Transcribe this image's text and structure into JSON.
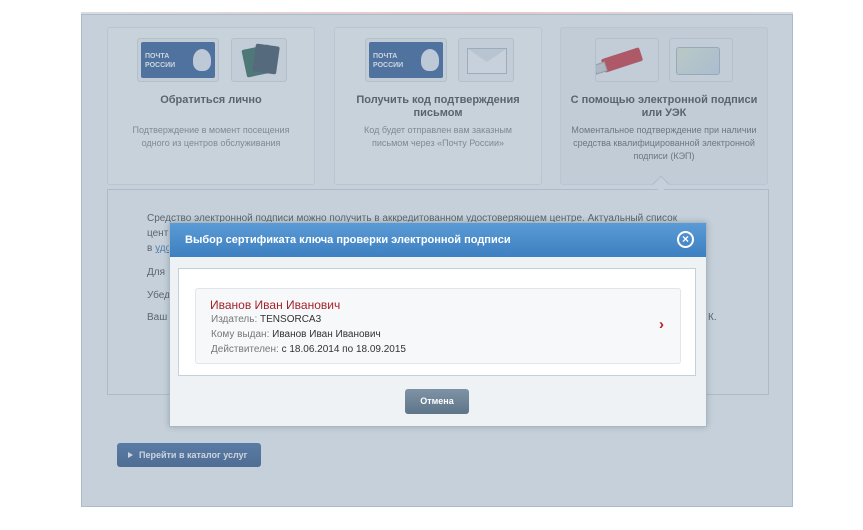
{
  "cards": [
    {
      "title": "Обратиться лично",
      "description": "Подтверждение в момент посещения одного из центров обслуживания"
    },
    {
      "title": "Получить код подтверждения письмом",
      "description": "Код будет отправлен вам заказным письмом через «Почту России»"
    },
    {
      "title": "С помощью электронной подписи или УЭК",
      "description": "Моментальное подтверждение при наличии средства квалифицированной электронной подписи (КЭП)"
    }
  ],
  "logo": {
    "line1": "ПОЧТА",
    "line2": "РОССИИ"
  },
  "info": {
    "line1": "Средство электронной подписи можно получить в аккредитованном удостоверяющем центре. Актуальный список",
    "line2": "цент",
    "line3_prefix": "в",
    "line3_link": "удо",
    "line4": "Для",
    "line5": "Убед",
    "line6": "Ваш",
    "line6_tail": "К."
  },
  "catalog_button": "Перейти в каталог услуг",
  "dialog": {
    "title": "Выбор сертификата ключа проверки электронной подписи",
    "close_symbol": "×",
    "cancel": "Отмена",
    "certificate": {
      "name": "Иванов Иван Иванович",
      "issuer_label": "Издатель:",
      "issuer": "TENSORCA3",
      "subject_label": "Кому выдан:",
      "subject": "Иванов Иван Иванович",
      "validity_label": "Действителен:",
      "validity": "с 18.06.2014 по 18.09.2015"
    }
  }
}
